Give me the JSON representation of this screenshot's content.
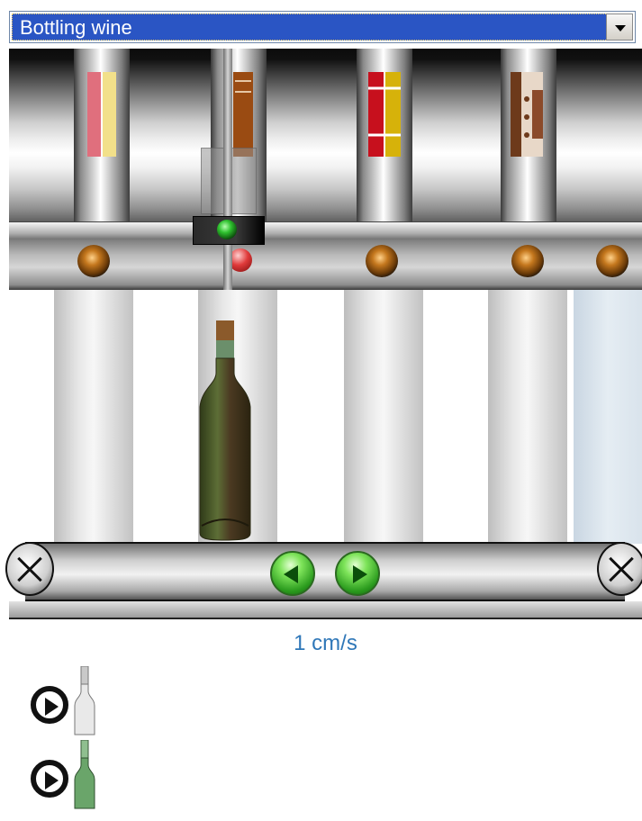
{
  "selector": {
    "value": "Bottling wine",
    "icon": "chevron-down-icon"
  },
  "machine": {
    "labels": [
      {
        "name": "pink-yellow-label",
        "colors": [
          "#e06f7d",
          "#f2e08a"
        ]
      },
      {
        "name": "brown-label",
        "colors": [
          "#9a4b12",
          "#e6c7a5"
        ]
      },
      {
        "name": "red-yellow-label",
        "colors": [
          "#c7101d",
          "#d6b20a"
        ]
      },
      {
        "name": "patterned-label",
        "colors": [
          "#6d3a1b",
          "#e8d8c8"
        ]
      }
    ],
    "indicator_color": "#22a222",
    "warning_light_color": "#e03a3a"
  },
  "bottle": {
    "glass_color": "#4a5a2e",
    "cap_color": "#8b5a2b"
  },
  "conveyor": {
    "prev_icon": "arrow-left-icon",
    "next_icon": "arrow-right-icon"
  },
  "speed": {
    "text": "1 cm/s"
  },
  "bottle_buttons": [
    {
      "name": "clear-bottle",
      "glass_color": "#e9e9e9"
    },
    {
      "name": "green-bottle",
      "glass_color": "#6aa56a"
    }
  ]
}
